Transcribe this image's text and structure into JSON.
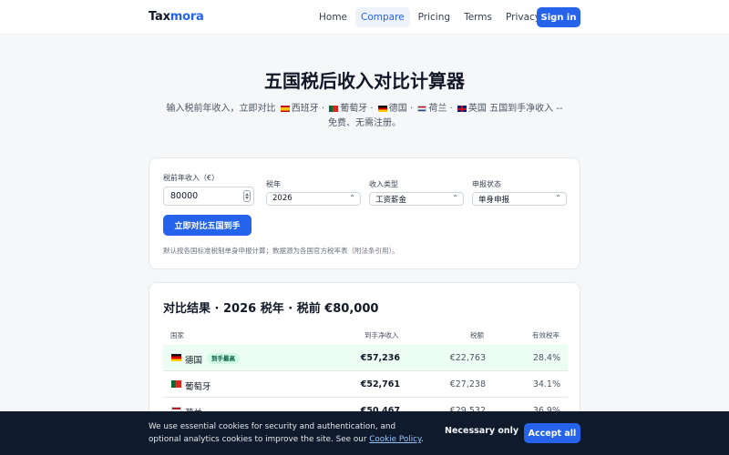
{
  "brand": {
    "prefix": "Tax",
    "accent": "mora"
  },
  "nav": {
    "links": [
      "Home",
      "Compare",
      "Pricing",
      "Terms",
      "Privacy"
    ],
    "active": "Compare",
    "signin": "Sign in"
  },
  "hero": {
    "title": "五国税后收入对比计算器",
    "sub_a": "输入税前年收入，立即对比",
    "es": "西班牙 ·",
    "pt": "葡萄牙 ·",
    "de": "德国 ·",
    "nl": "荷兰 ·",
    "gb": "英国 五国到手净收入 --",
    "sub_b": "免费、无需注册。"
  },
  "form": {
    "income_label": "税前年收入（€）",
    "income_value": "80000",
    "year_label": "税年",
    "year_value": "2026",
    "type_label": "收入类型",
    "type_value": "工资薪金",
    "status_label": "申报状态",
    "status_value": "单身申报",
    "submit": "立即对比五国到手",
    "note": "默认按各国标准税制单身申报计算；数据源为各国官方税率表（附法条引用）。"
  },
  "results": {
    "title": "对比结果 · 2026 税年 · 税前 €80,000",
    "headers": {
      "country": "国家",
      "net": "到手净收入",
      "tax": "税额",
      "rate": "有效税率"
    },
    "best_badge": "到手最高",
    "rows": [
      {
        "country": "德国",
        "net": "€57,236",
        "tax": "€22,763",
        "rate": "28.4%"
      },
      {
        "country": "葡萄牙",
        "net": "€52,761",
        "tax": "€27,238",
        "rate": "34.1%"
      },
      {
        "country": "荷兰",
        "net": "€50,467",
        "tax": "€29,532",
        "rate": "36.9%"
      }
    ]
  },
  "cookie": {
    "text": "We use essential cookies for security and authentication, and optional analytics cookies to improve the site. See our",
    "link": "Cookie Policy",
    "end": ".",
    "necessary": "Necessary only",
    "accept": "Accept all"
  },
  "colors": {
    "primary": "#2563eb",
    "banner": "#0f1b2d",
    "best_row": "#ecfdf3"
  }
}
